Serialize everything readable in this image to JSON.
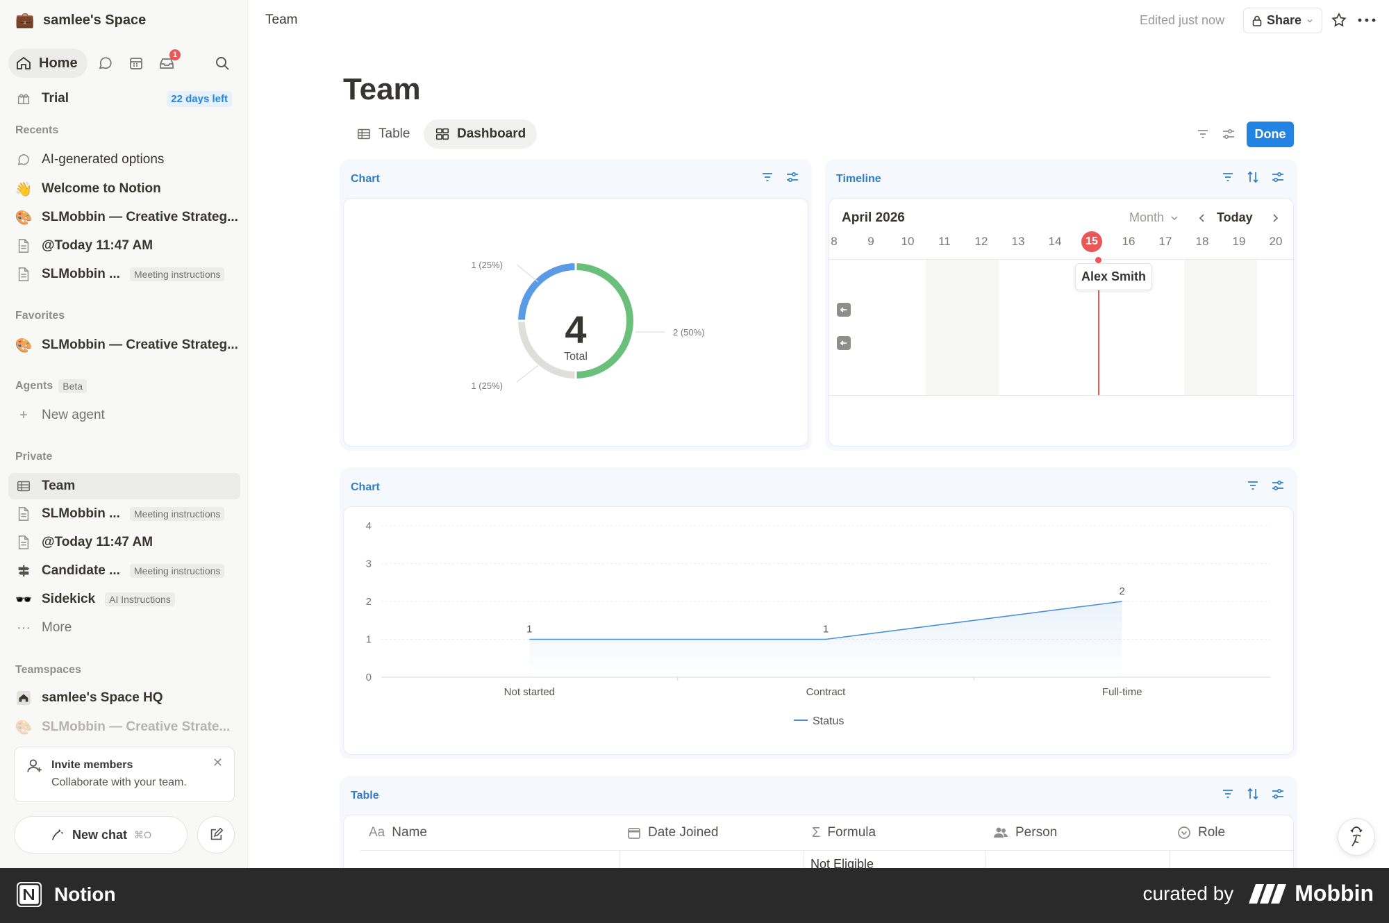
{
  "sidebar": {
    "workspace": "samlee's Space",
    "home_label": "Home",
    "inbox_badge": "1",
    "trial_label": "Trial",
    "trial_tag": "22 days left",
    "recents_header": "Recents",
    "recents": [
      {
        "label": "AI-generated options",
        "icon": "chat-bubble-icon"
      },
      {
        "label": "Welcome to Notion",
        "icon": "waving-hand-icon"
      },
      {
        "label": "SLMobbin — Creative Strateg...",
        "icon": "palette-icon"
      },
      {
        "label": "@Today 11:47 AM",
        "icon": "page-icon"
      },
      {
        "label": "SLMobbin ...",
        "icon": "page-icon",
        "tag": "Meeting instructions"
      }
    ],
    "favorites_header": "Favorites",
    "favorites": [
      {
        "label": "SLMobbin — Creative Strateg...",
        "icon": "palette-icon"
      }
    ],
    "agents_header": "Agents",
    "agents_tag": "Beta",
    "new_agent_label": "New agent",
    "private_header": "Private",
    "private": [
      {
        "label": "Team",
        "icon": "table-icon"
      },
      {
        "label": "SLMobbin ...",
        "icon": "page-icon",
        "tag": "Meeting instructions"
      },
      {
        "label": "@Today 11:47 AM",
        "icon": "page-icon"
      },
      {
        "label": "Candidate ...",
        "icon": "signpost-icon",
        "tag": "Meeting instructions"
      },
      {
        "label": "Sidekick",
        "icon": "glasses-icon",
        "tag": "AI Instructions"
      },
      {
        "label": "More",
        "icon": "more-dots-icon"
      }
    ],
    "teamspaces_header": "Teamspaces",
    "teamspaces": [
      {
        "label": "samlee's Space HQ",
        "icon": "house-icon"
      },
      {
        "label": "SLMobbin — Creative Strate...",
        "icon": "palette-icon"
      }
    ],
    "invite_title": "Invite members",
    "invite_subtitle": "Collaborate with your team.",
    "new_chat_label": "New chat",
    "new_chat_shortcut": "⌘O"
  },
  "header": {
    "breadcrumb": "Team",
    "edited": "Edited just now",
    "share_label": "Share"
  },
  "page": {
    "title": "Team",
    "views": [
      {
        "label": "Table",
        "active": false
      },
      {
        "label": "Dashboard",
        "active": true
      }
    ],
    "done_label": "Done"
  },
  "donut_card": {
    "title": "Chart",
    "total": "4",
    "total_label": "Total",
    "labels": [
      "1 (25%)",
      "2 (50%)",
      "1 (25%)"
    ]
  },
  "timeline_card": {
    "title": "Timeline",
    "month": "April 2026",
    "scale": "Month",
    "today_label": "Today",
    "days": [
      "8",
      "9",
      "10",
      "11",
      "12",
      "13",
      "14",
      "15",
      "16",
      "17",
      "18",
      "19",
      "20"
    ],
    "today_day": "15",
    "person": "Alex Smith"
  },
  "line_card": {
    "title": "Chart"
  },
  "table_card": {
    "title": "Table",
    "columns": [
      {
        "label": "Name",
        "icon": "title-aa-icon"
      },
      {
        "label": "Date Joined",
        "icon": "calendar-icon"
      },
      {
        "label": "Formula",
        "icon": "sigma-icon"
      },
      {
        "label": "Person",
        "icon": "people-icon"
      },
      {
        "label": "Role",
        "icon": "select-icon"
      }
    ],
    "first_row_formula": "Not Eligible"
  },
  "chart_data": [
    {
      "type": "pie",
      "values": [
        1,
        2,
        1
      ],
      "data_labels": [
        "1 (25%)",
        "2 (50%)",
        "1 (25%)"
      ],
      "colors": [
        "#5b9be6",
        "#6abf7b",
        "#dededb"
      ],
      "total": 4,
      "total_label": "Total"
    },
    {
      "type": "line",
      "categories": [
        "Not started",
        "Contract",
        "Full-time"
      ],
      "series": [
        {
          "name": "Status",
          "values": [
            1,
            1,
            2
          ],
          "color": "#4a90d9"
        }
      ],
      "ylim": [
        0,
        4
      ],
      "yticks": [
        0,
        1,
        2,
        3,
        4
      ],
      "grid": true,
      "legend": "bottom"
    }
  ],
  "footer": {
    "brand": "Notion",
    "curated": "curated by",
    "mobbin": "Mobbin"
  }
}
